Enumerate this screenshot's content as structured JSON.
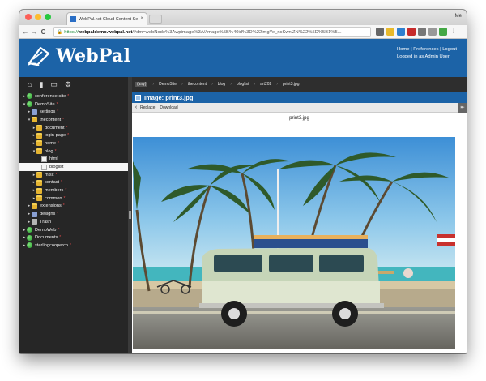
{
  "browser": {
    "tab_title": "WebPal.net Cloud Content Se",
    "tab_close": "×",
    "user_badge": "Me",
    "url_scheme": "https://",
    "url_host": "webpaldemo.webpal.net",
    "url_path": "/#dm=webNode%3Awpimage%3A//image%5B%40id%3D%22imgYe_ncKwniZN%22%5D%5B1%5...",
    "nav_back": "←",
    "nav_forward": "→",
    "nav_reload": "C",
    "nav_info": "ⓘ",
    "lock_icon": "🔒"
  },
  "app": {
    "logo_text": "WebPal",
    "links": {
      "home": "Home",
      "preferences": "Preferences",
      "logout": "Logout",
      "sep": "|",
      "status": "Logged in as Admin User"
    }
  },
  "tree": [
    {
      "label": "conference-site",
      "icon": "globe",
      "depth": 0,
      "arrow": "▸",
      "star": "*"
    },
    {
      "label": "DemoSite",
      "icon": "globe",
      "depth": 0,
      "arrow": "▾",
      "star": "*"
    },
    {
      "label": "settings",
      "icon": "settings",
      "depth": 1,
      "arrow": "▸",
      "star": "*"
    },
    {
      "label": "thecontent",
      "icon": "folder",
      "depth": 1,
      "arrow": "▾",
      "star": "*"
    },
    {
      "label": "document",
      "icon": "folder",
      "depth": 2,
      "arrow": "▸",
      "star": "*"
    },
    {
      "label": "login-page",
      "icon": "folder",
      "depth": 2,
      "arrow": "▸",
      "star": "*"
    },
    {
      "label": "home",
      "icon": "folder",
      "depth": 2,
      "arrow": "▸",
      "star": "*"
    },
    {
      "label": "blog",
      "icon": "folder",
      "depth": 2,
      "arrow": "▾",
      "star": "*"
    },
    {
      "label": "html",
      "icon": "page",
      "depth": 3,
      "arrow": "",
      "star": ""
    },
    {
      "label": "bloglist",
      "icon": "page",
      "depth": 3,
      "arrow": "",
      "star": "",
      "selected": true
    },
    {
      "label": "misc",
      "icon": "folder",
      "depth": 2,
      "arrow": "▸",
      "star": "*"
    },
    {
      "label": "contact",
      "icon": "folder",
      "depth": 2,
      "arrow": "▸",
      "star": "*"
    },
    {
      "label": "members",
      "icon": "folder",
      "depth": 2,
      "arrow": "▸",
      "star": "*"
    },
    {
      "label": "common",
      "icon": "folder",
      "depth": 2,
      "arrow": "▸",
      "star": "*"
    },
    {
      "label": "extensions",
      "icon": "folder",
      "depth": 1,
      "arrow": "▸",
      "star": "*"
    },
    {
      "label": "designs",
      "icon": "settings",
      "depth": 1,
      "arrow": "▸",
      "star": "*"
    },
    {
      "label": "Trash",
      "icon": "trash",
      "depth": 1,
      "arrow": "▸",
      "star": ""
    },
    {
      "label": "DemoWeb",
      "icon": "globe",
      "depth": 0,
      "arrow": "▸",
      "star": "*"
    },
    {
      "label": "Documents",
      "icon": "globe",
      "depth": 0,
      "arrow": "▸",
      "star": "*"
    },
    {
      "label": "sterlingcooperco",
      "icon": "globe",
      "depth": 0,
      "arrow": "▸",
      "star": "*"
    }
  ],
  "breadcrumb": [
    "(any)",
    "DemoSite",
    "thecontent",
    "blog",
    "bloglist",
    "art202",
    "print3.jpg"
  ],
  "breadcrumb_sep": "›",
  "panel": {
    "title": "Image: print3.jpg",
    "replace": "Replace",
    "download": "Download",
    "back": "‹",
    "filename": "print3.jpg"
  },
  "colors": {
    "accent": "#1c63a7"
  }
}
